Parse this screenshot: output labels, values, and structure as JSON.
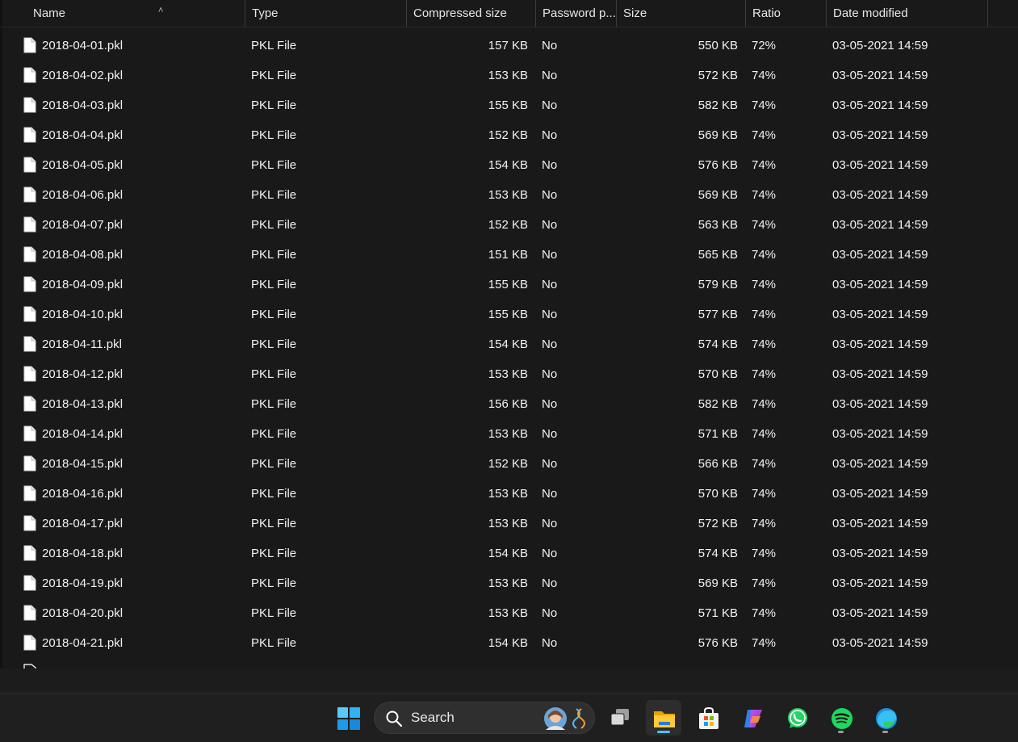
{
  "columns": [
    {
      "key": "name",
      "label": "Name"
    },
    {
      "key": "type",
      "label": "Type"
    },
    {
      "key": "compressed",
      "label": "Compressed size"
    },
    {
      "key": "password",
      "label": "Password p..."
    },
    {
      "key": "size",
      "label": "Size"
    },
    {
      "key": "ratio",
      "label": "Ratio"
    },
    {
      "key": "date",
      "label": "Date modified"
    }
  ],
  "sort": {
    "column": "name",
    "direction": "ascending",
    "icon": "chevron-up-icon"
  },
  "files": [
    {
      "name": "2018-04-01.pkl",
      "type": "PKL File",
      "compressed": "157 KB",
      "password": "No",
      "size": "550 KB",
      "ratio": "72%",
      "date": "03-05-2021 14:59"
    },
    {
      "name": "2018-04-02.pkl",
      "type": "PKL File",
      "compressed": "153 KB",
      "password": "No",
      "size": "572 KB",
      "ratio": "74%",
      "date": "03-05-2021 14:59"
    },
    {
      "name": "2018-04-03.pkl",
      "type": "PKL File",
      "compressed": "155 KB",
      "password": "No",
      "size": "582 KB",
      "ratio": "74%",
      "date": "03-05-2021 14:59"
    },
    {
      "name": "2018-04-04.pkl",
      "type": "PKL File",
      "compressed": "152 KB",
      "password": "No",
      "size": "569 KB",
      "ratio": "74%",
      "date": "03-05-2021 14:59"
    },
    {
      "name": "2018-04-05.pkl",
      "type": "PKL File",
      "compressed": "154 KB",
      "password": "No",
      "size": "576 KB",
      "ratio": "74%",
      "date": "03-05-2021 14:59"
    },
    {
      "name": "2018-04-06.pkl",
      "type": "PKL File",
      "compressed": "153 KB",
      "password": "No",
      "size": "569 KB",
      "ratio": "74%",
      "date": "03-05-2021 14:59"
    },
    {
      "name": "2018-04-07.pkl",
      "type": "PKL File",
      "compressed": "152 KB",
      "password": "No",
      "size": "563 KB",
      "ratio": "74%",
      "date": "03-05-2021 14:59"
    },
    {
      "name": "2018-04-08.pkl",
      "type": "PKL File",
      "compressed": "151 KB",
      "password": "No",
      "size": "565 KB",
      "ratio": "74%",
      "date": "03-05-2021 14:59"
    },
    {
      "name": "2018-04-09.pkl",
      "type": "PKL File",
      "compressed": "155 KB",
      "password": "No",
      "size": "579 KB",
      "ratio": "74%",
      "date": "03-05-2021 14:59"
    },
    {
      "name": "2018-04-10.pkl",
      "type": "PKL File",
      "compressed": "155 KB",
      "password": "No",
      "size": "577 KB",
      "ratio": "74%",
      "date": "03-05-2021 14:59"
    },
    {
      "name": "2018-04-11.pkl",
      "type": "PKL File",
      "compressed": "154 KB",
      "password": "No",
      "size": "574 KB",
      "ratio": "74%",
      "date": "03-05-2021 14:59"
    },
    {
      "name": "2018-04-12.pkl",
      "type": "PKL File",
      "compressed": "153 KB",
      "password": "No",
      "size": "570 KB",
      "ratio": "74%",
      "date": "03-05-2021 14:59"
    },
    {
      "name": "2018-04-13.pkl",
      "type": "PKL File",
      "compressed": "156 KB",
      "password": "No",
      "size": "582 KB",
      "ratio": "74%",
      "date": "03-05-2021 14:59"
    },
    {
      "name": "2018-04-14.pkl",
      "type": "PKL File",
      "compressed": "153 KB",
      "password": "No",
      "size": "571 KB",
      "ratio": "74%",
      "date": "03-05-2021 14:59"
    },
    {
      "name": "2018-04-15.pkl",
      "type": "PKL File",
      "compressed": "152 KB",
      "password": "No",
      "size": "566 KB",
      "ratio": "74%",
      "date": "03-05-2021 14:59"
    },
    {
      "name": "2018-04-16.pkl",
      "type": "PKL File",
      "compressed": "153 KB",
      "password": "No",
      "size": "570 KB",
      "ratio": "74%",
      "date": "03-05-2021 14:59"
    },
    {
      "name": "2018-04-17.pkl",
      "type": "PKL File",
      "compressed": "153 KB",
      "password": "No",
      "size": "572 KB",
      "ratio": "74%",
      "date": "03-05-2021 14:59"
    },
    {
      "name": "2018-04-18.pkl",
      "type": "PKL File",
      "compressed": "154 KB",
      "password": "No",
      "size": "574 KB",
      "ratio": "74%",
      "date": "03-05-2021 14:59"
    },
    {
      "name": "2018-04-19.pkl",
      "type": "PKL File",
      "compressed": "153 KB",
      "password": "No",
      "size": "569 KB",
      "ratio": "74%",
      "date": "03-05-2021 14:59"
    },
    {
      "name": "2018-04-20.pkl",
      "type": "PKL File",
      "compressed": "153 KB",
      "password": "No",
      "size": "571 KB",
      "ratio": "74%",
      "date": "03-05-2021 14:59"
    },
    {
      "name": "2018-04-21.pkl",
      "type": "PKL File",
      "compressed": "154 KB",
      "password": "No",
      "size": "576 KB",
      "ratio": "74%",
      "date": "03-05-2021 14:59"
    }
  ],
  "taskbar": {
    "search_label": "Search",
    "icons": [
      {
        "name": "start-icon"
      },
      {
        "name": "task-view-icon"
      },
      {
        "name": "file-explorer-icon",
        "active": true
      },
      {
        "name": "microsoft-store-icon"
      },
      {
        "name": "copilot-icon"
      },
      {
        "name": "whatsapp-icon"
      },
      {
        "name": "spotify-icon"
      },
      {
        "name": "edge-icon"
      }
    ]
  },
  "colors": {
    "background": "#191919",
    "text": "#f2f2f2",
    "accent": "#4cc2ff",
    "whatsapp": "#25d366",
    "spotify": "#1ed760"
  }
}
